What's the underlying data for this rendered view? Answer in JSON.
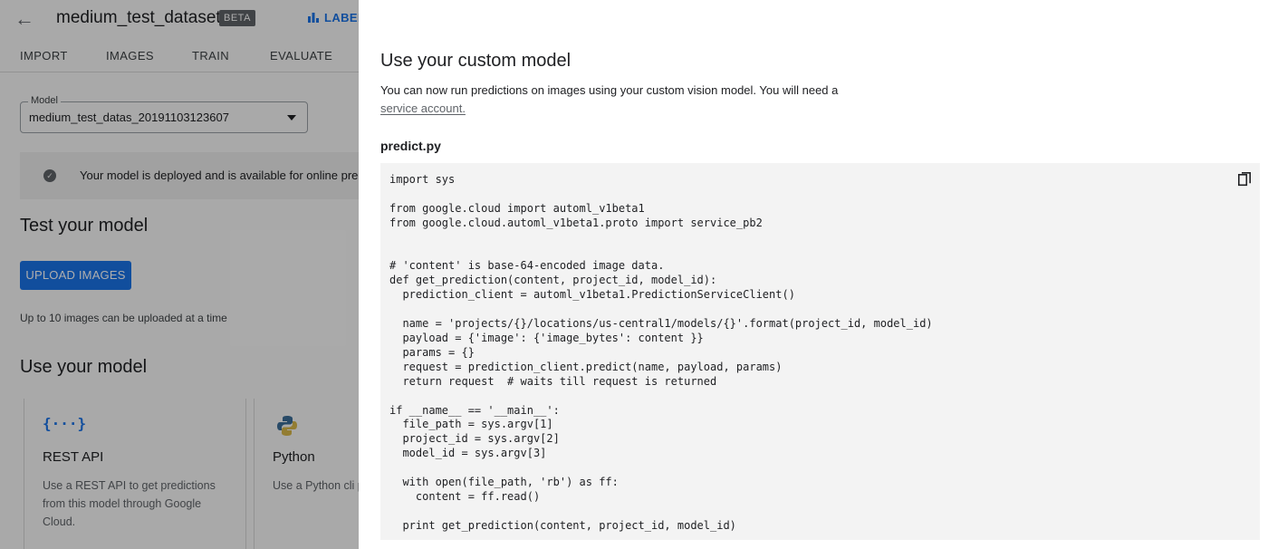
{
  "header": {
    "title": "medium_test_dataset",
    "badge": "BETA",
    "label_button": "LABEL"
  },
  "tabs": [
    {
      "label": "IMPORT"
    },
    {
      "label": "IMAGES"
    },
    {
      "label": "TRAIN"
    },
    {
      "label": "EVALUATE"
    }
  ],
  "model_select": {
    "label": "Model",
    "value": "medium_test_datas_20191103123607"
  },
  "deploy_banner": {
    "text": "Your model is deployed and is available for online prec"
  },
  "test_section": {
    "heading": "Test your model",
    "upload_button": "UPLOAD IMAGES",
    "hint": "Up to 10 images can be uploaded at a time"
  },
  "use_section": {
    "heading": "Use your model",
    "cards": [
      {
        "icon": "braces-icon",
        "icon_text": "{···}",
        "title": "REST API",
        "desc": "Use a REST API to get predictions from this model through Google Cloud."
      },
      {
        "icon": "python-icon",
        "title": "Python",
        "desc": "Use a Python cli predictions from"
      }
    ]
  },
  "drawer": {
    "title": "Use your custom model",
    "desc_text": "You can now run predictions on images using your custom vision model. You will need a",
    "link_text": "service account.",
    "file_name": "predict.py",
    "code": "import sys\n\nfrom google.cloud import automl_v1beta1\nfrom google.cloud.automl_v1beta1.proto import service_pb2\n\n\n# 'content' is base-64-encoded image data.\ndef get_prediction(content, project_id, model_id):\n  prediction_client = automl_v1beta1.PredictionServiceClient()\n\n  name = 'projects/{}/locations/us-central1/models/{}'.format(project_id, model_id)\n  payload = {'image': {'image_bytes': content }}\n  params = {}\n  request = prediction_client.predict(name, payload, params)\n  return request  # waits till request is returned\n\nif __name__ == '__main__':\n  file_path = sys.argv[1]\n  project_id = sys.argv[2]\n  model_id = sys.argv[3]\n\n  with open(file_path, 'rb') as ff:\n    content = ff.read()\n\n  print get_prediction(content, project_id, model_id)"
  },
  "colors": {
    "accent": "#1a73e8",
    "scrim": "rgba(0,0,0,0.32)",
    "code_bg": "#f3f3f3"
  }
}
